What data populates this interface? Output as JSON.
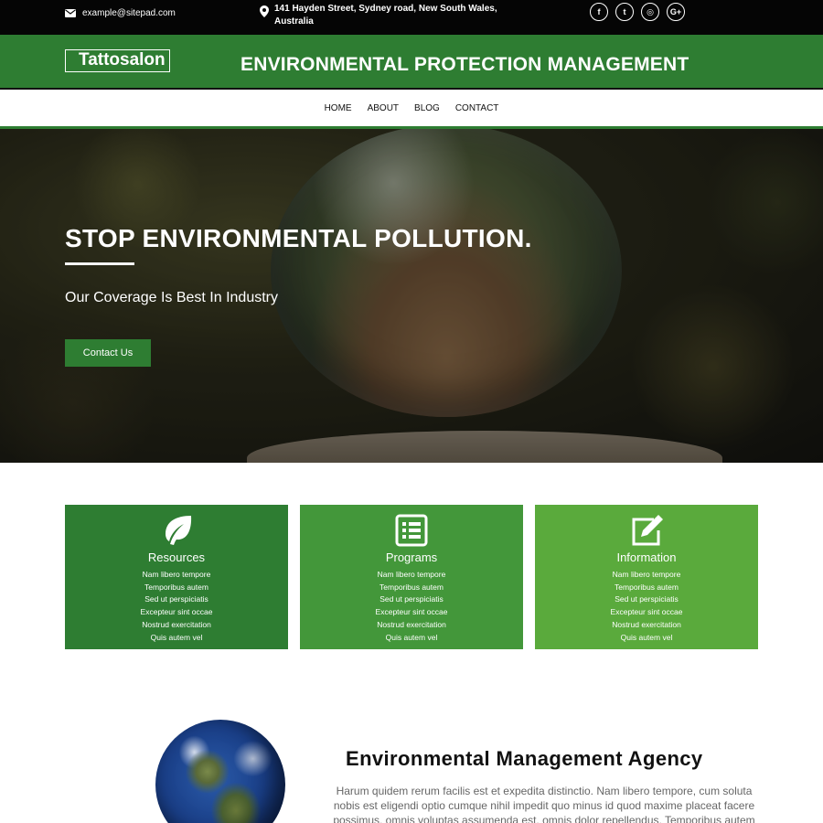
{
  "topbar": {
    "email": "example@sitepad.com",
    "address": "141 Hayden Street, Sydney road, New South Wales, Australia",
    "social": [
      {
        "icon": "facebook-icon",
        "glyph": "f"
      },
      {
        "icon": "twitter-icon",
        "glyph": "t"
      },
      {
        "icon": "instagram-icon",
        "glyph": "◎"
      },
      {
        "icon": "google-plus-icon",
        "glyph": "G+"
      }
    ]
  },
  "header": {
    "logo": "Tattosalon",
    "title": "ENVIRONMENTAL PROTECTION MANAGEMENT"
  },
  "nav": [
    "HOME",
    "ABOUT",
    "BLOG",
    "CONTACT"
  ],
  "hero": {
    "title": "STOP ENVIRONMENTAL POLLUTION.",
    "subtitle": "Our Coverage Is Best In Industry",
    "button": "Contact Us"
  },
  "features": [
    {
      "title": "Resources",
      "icon": "leaf-icon",
      "color": "#2e7d32",
      "items": [
        "Nam libero tempore",
        "Temporibus autem",
        "Sed ut perspiciatis",
        "Excepteur sint occae",
        "Nostrud exercitation",
        "Quis autem vel"
      ]
    },
    {
      "title": "Programs",
      "icon": "list-icon",
      "color": "#43973a",
      "items": [
        "Nam libero tempore",
        "Temporibus autem",
        "Sed ut perspiciatis",
        "Excepteur sint occae",
        "Nostrud exercitation",
        "Quis autem vel"
      ]
    },
    {
      "title": "Information",
      "icon": "edit-icon",
      "color": "#5aaa3c",
      "items": [
        "Nam libero tempore",
        "Temporibus autem",
        "Sed ut perspiciatis",
        "Excepteur sint occae",
        "Nostrud exercitation",
        "Quis autem vel"
      ]
    }
  ],
  "about": {
    "title": "Environmental Management Agency",
    "text": "Harum quidem rerum facilis est et expedita distinctio. Nam libero tempore, cum soluta nobis est eligendi optio cumque nihil impedit quo minus id quod maxime placeat facere possimus, omnis voluptas assumenda est, omnis dolor repellendus. Temporibus autem"
  }
}
